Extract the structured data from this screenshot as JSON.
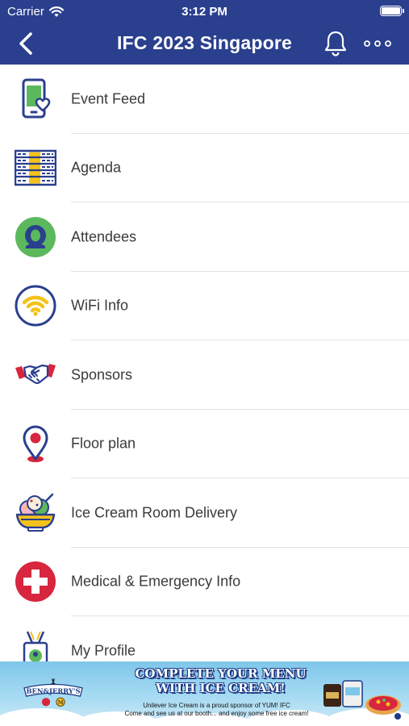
{
  "status_bar": {
    "carrier": "Carrier",
    "time": "3:12 PM"
  },
  "nav": {
    "title": "IFC 2023 Singapore"
  },
  "menu": [
    {
      "label": "Event Feed",
      "icon": "phone-heart-icon"
    },
    {
      "label": "Agenda",
      "icon": "agenda-table-icon"
    },
    {
      "label": "Attendees",
      "icon": "attendee-avatar-icon"
    },
    {
      "label": "WiFi Info",
      "icon": "wifi-icon"
    },
    {
      "label": "Sponsors",
      "icon": "handshake-icon"
    },
    {
      "label": "Floor plan",
      "icon": "map-pin-icon"
    },
    {
      "label": "Ice Cream Room Delivery",
      "icon": "ice-cream-bowl-icon"
    },
    {
      "label": "Medical & Emergency Info",
      "icon": "medical-cross-icon"
    },
    {
      "label": "My Profile",
      "icon": "id-badge-icon"
    }
  ],
  "ad": {
    "headline_1": "COMPLETE YOUR MENU",
    "headline_2": "WITH ICE CREAM!",
    "sub_1": "Unilever Ice Cream is a proud sponsor of YUM! IFC",
    "sub_2": "Come and see us at our booth... and enjoy some free ice cream!",
    "brand": "BEN&JERRY'S",
    "brand2": "M"
  },
  "colors": {
    "nav_bg": "#2a3f8e",
    "label": "#3a3a3a",
    "accent_red": "#d7263d",
    "accent_yellow": "#f4c21a",
    "accent_green": "#5cb85c"
  }
}
